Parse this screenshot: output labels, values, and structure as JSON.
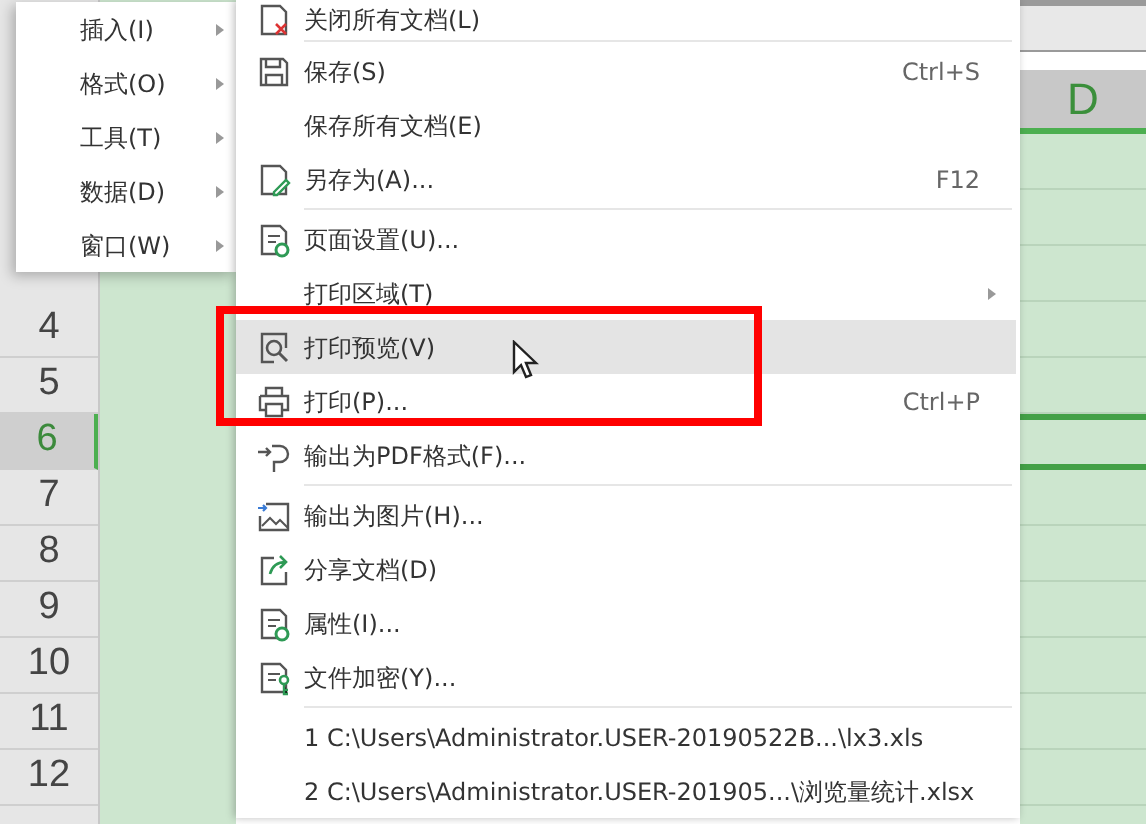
{
  "sheet": {
    "column_header": {
      "label": "D",
      "selected": true
    },
    "row_headers": [
      {
        "label": "4",
        "selected": false
      },
      {
        "label": "5",
        "selected": false
      },
      {
        "label": "6",
        "selected": true
      },
      {
        "label": "7",
        "selected": false
      },
      {
        "label": "8",
        "selected": false
      },
      {
        "label": "9",
        "selected": false
      },
      {
        "label": "10",
        "selected": false
      },
      {
        "label": "11",
        "selected": false
      },
      {
        "label": "12",
        "selected": false
      }
    ]
  },
  "submenu": {
    "items": [
      {
        "label": "插入(I)",
        "has_submenu": true
      },
      {
        "label": "格式(O)",
        "has_submenu": true
      },
      {
        "label": "工具(T)",
        "has_submenu": true
      },
      {
        "label": "数据(D)",
        "has_submenu": true
      },
      {
        "label": "窗口(W)",
        "has_submenu": true
      }
    ]
  },
  "menu": {
    "items": [
      {
        "label": "关闭所有文档(L)",
        "selected": false,
        "separator_after": true
      },
      {
        "label": "保存(S)",
        "shortcut": "Ctrl+S",
        "selected": false
      },
      {
        "label": "保存所有文档(E)",
        "selected": false
      },
      {
        "label": "另存为(A)...",
        "shortcut": "F12",
        "selected": false,
        "separator_after": true
      },
      {
        "label": "页面设置(U)...",
        "selected": false
      },
      {
        "label": "打印区域(T)",
        "has_submenu": true,
        "selected": false
      },
      {
        "label": "打印预览(V)",
        "selected": true
      },
      {
        "label": "打印(P)...",
        "shortcut": "Ctrl+P",
        "selected": false
      },
      {
        "label": "输出为PDF格式(F)...",
        "selected": false,
        "separator_after": true
      },
      {
        "label": "输出为图片(H)...",
        "selected": false
      },
      {
        "label": "分享文档(D)",
        "selected": false
      },
      {
        "label": "属性(I)...",
        "selected": false
      },
      {
        "label": "文件加密(Y)...",
        "selected": false,
        "separator_after": true
      },
      {
        "label": "1 C:\\Users\\Administrator.USER-20190522B...\\lx3.xls",
        "selected": false
      },
      {
        "label": "2 C:\\Users\\Administrator.USER-201905...\\浏览量统计.xlsx",
        "selected": false
      }
    ]
  }
}
